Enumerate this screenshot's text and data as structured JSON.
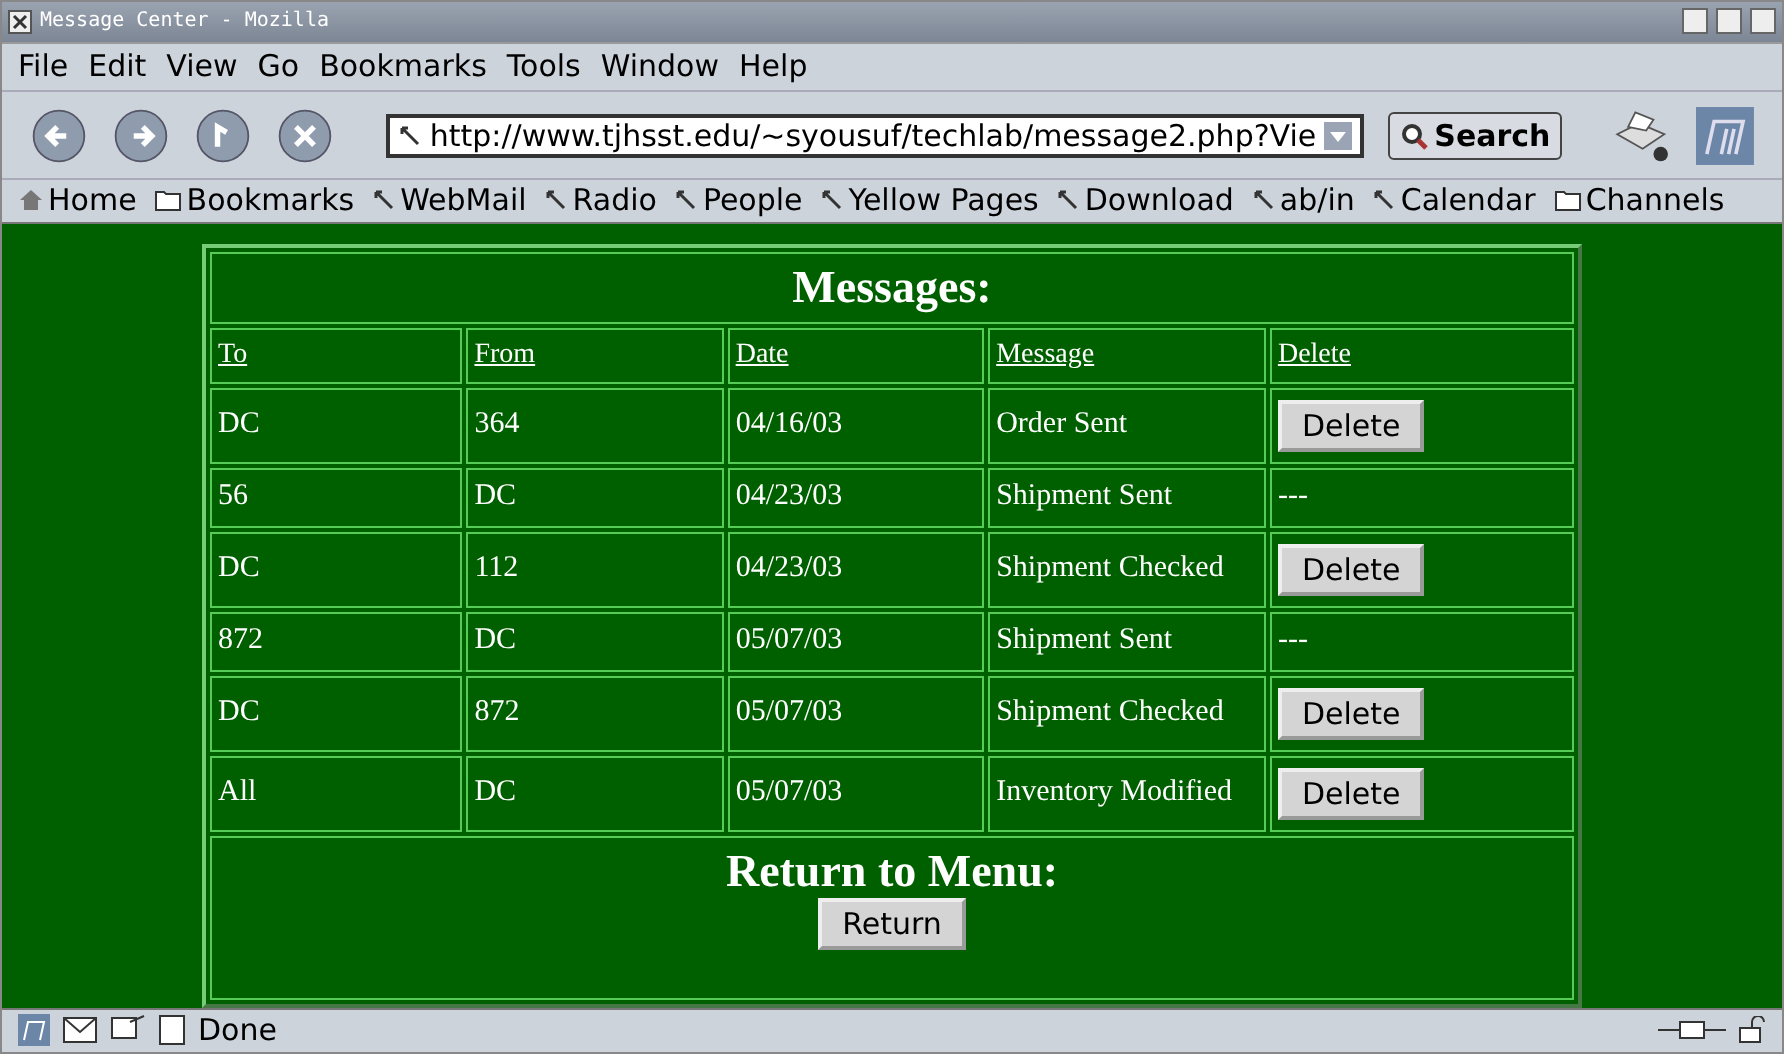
{
  "window": {
    "title": "Message Center - Mozilla"
  },
  "menu": [
    "File",
    "Edit",
    "View",
    "Go",
    "Bookmarks",
    "Tools",
    "Window",
    "Help"
  ],
  "toolbar": {
    "url": "http://www.tjhsst.edu/~syousuf/techlab/message2.php?Vie",
    "search": "Search"
  },
  "bookmarks": [
    {
      "kind": "home",
      "label": "Home"
    },
    {
      "kind": "folder",
      "label": "Bookmarks"
    },
    {
      "kind": "link",
      "label": "WebMail"
    },
    {
      "kind": "link",
      "label": "Radio"
    },
    {
      "kind": "link",
      "label": "People"
    },
    {
      "kind": "link",
      "label": "Yellow Pages"
    },
    {
      "kind": "link",
      "label": "Download"
    },
    {
      "kind": "link",
      "label": "ab/in"
    },
    {
      "kind": "link",
      "label": "Calendar"
    },
    {
      "kind": "folder",
      "label": "Channels"
    }
  ],
  "table": {
    "title": "Messages:",
    "columns": [
      "To",
      "From",
      "Date",
      "Message",
      "Delete"
    ],
    "rows": [
      {
        "to": "DC",
        "from": "364",
        "date": "04/16/03",
        "message": "Order Sent",
        "delete": {
          "kind": "button",
          "label": "Delete"
        }
      },
      {
        "to": "56",
        "from": "DC",
        "date": "04/23/03",
        "message": "Shipment Sent",
        "delete": {
          "kind": "text",
          "label": "---"
        }
      },
      {
        "to": "DC",
        "from": "112",
        "date": "04/23/03",
        "message": "Shipment Checked",
        "delete": {
          "kind": "button",
          "label": "Delete"
        }
      },
      {
        "to": "872",
        "from": "DC",
        "date": "05/07/03",
        "message": "Shipment Sent",
        "delete": {
          "kind": "text",
          "label": "---"
        }
      },
      {
        "to": "DC",
        "from": "872",
        "date": "05/07/03",
        "message": "Shipment Checked",
        "delete": {
          "kind": "button",
          "label": "Delete"
        }
      },
      {
        "to": "All",
        "from": "DC",
        "date": "05/07/03",
        "message": "Inventory Modified",
        "delete": {
          "kind": "button",
          "label": "Delete"
        }
      }
    ],
    "footer": {
      "title": "Return to Menu:",
      "button": "Return"
    }
  },
  "status_bar": {
    "text": "Done"
  }
}
